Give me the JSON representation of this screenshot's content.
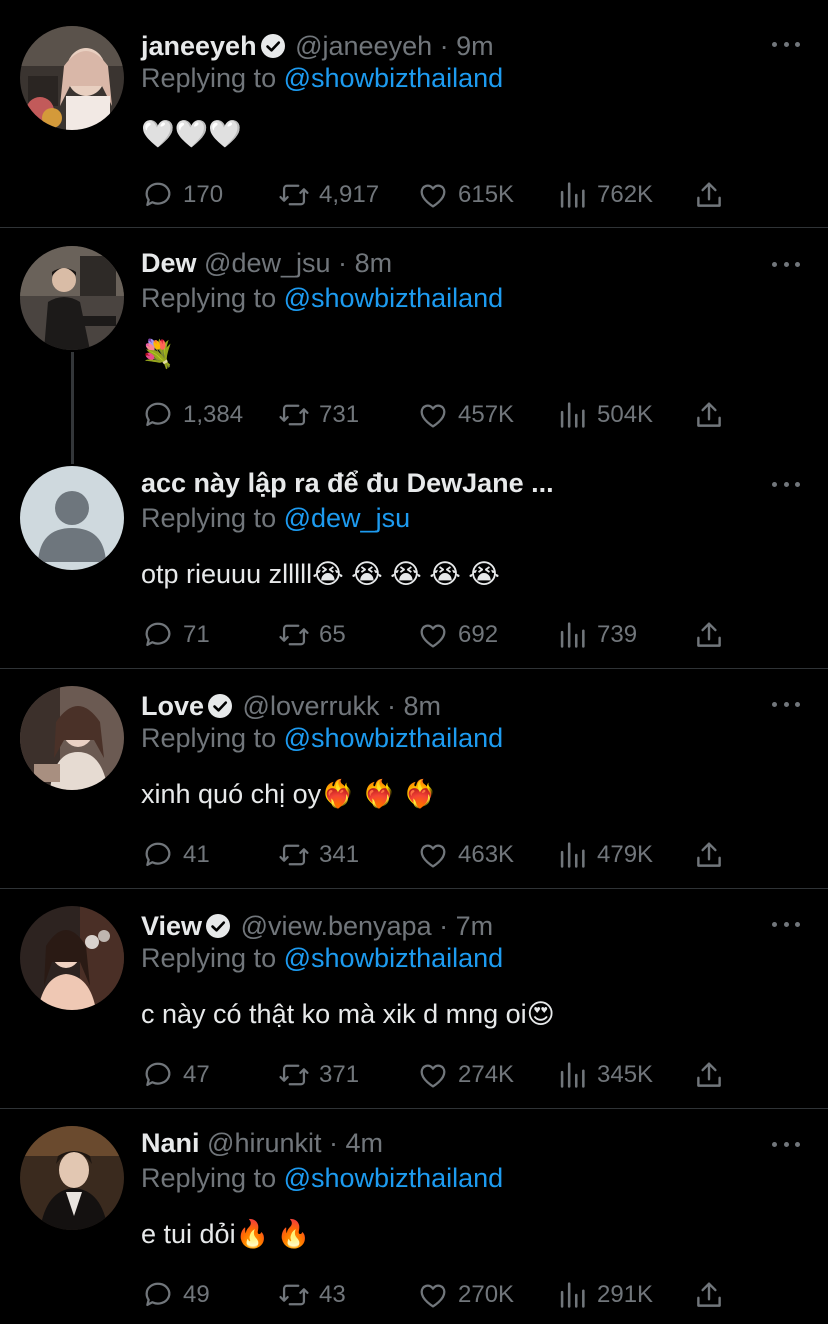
{
  "colors": {
    "background": "#000000",
    "text": "#e7e9ea",
    "muted": "#71767b",
    "accent": "#1d9bf0",
    "divider": "#2f3336"
  },
  "replying_prefix": "Replying to",
  "tweets": [
    {
      "name": "janeeyeh",
      "verified": true,
      "handle": "@janeeyeh",
      "sep": "·",
      "time": "9m",
      "replying_to": "@showbizthailand",
      "text": "🤍🤍🤍",
      "replies": "170",
      "retweets": "4,917",
      "likes": "615K",
      "views": "762K"
    },
    {
      "name": "Dew",
      "verified": false,
      "handle": "@dew_jsu",
      "sep": "·",
      "time": "8m",
      "replying_to": "@showbizthailand",
      "text": "💐",
      "replies": "1,384",
      "retweets": "731",
      "likes": "457K",
      "views": "504K"
    },
    {
      "name": "acc này lập ra để đu DewJane ...",
      "verified": false,
      "handle": "",
      "sep": "",
      "time": "",
      "replying_to": "@dew_jsu",
      "text": "otp rieuuu zlllll😭 😭 😭 😭 😭",
      "replies": "71",
      "retweets": "65",
      "likes": "692",
      "views": "739"
    },
    {
      "name": "Love",
      "verified": true,
      "handle": "@loverrukk",
      "sep": "·",
      "time": "8m",
      "replying_to": "@showbizthailand",
      "text": "xinh quó chị oy❤️‍🔥 ❤️‍🔥 ❤️‍🔥",
      "replies": "41",
      "retweets": "341",
      "likes": "463K",
      "views": "479K"
    },
    {
      "name": "View",
      "verified": true,
      "handle": "@view.benyapa",
      "sep": "·",
      "time": "7m",
      "replying_to": "@showbizthailand",
      "text": "c này có thật ko mà xik d mng oi😍",
      "replies": "47",
      "retweets": "371",
      "likes": "274K",
      "views": "345K"
    },
    {
      "name": "Nani",
      "verified": false,
      "handle": "@hirunkit",
      "sep": "·",
      "time": "4m",
      "replying_to": "@showbizthailand",
      "text": "e tui dỏi🔥 🔥",
      "replies": "49",
      "retweets": "43",
      "likes": "270K",
      "views": "291K"
    }
  ]
}
